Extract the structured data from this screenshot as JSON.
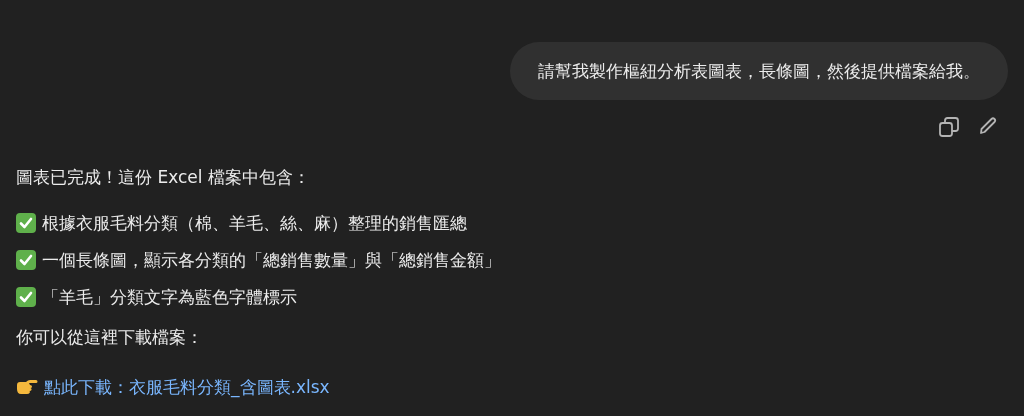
{
  "user_message": {
    "text": "請幫我製作樞紐分析表圖表，長條圖，然後提供檔案給我。"
  },
  "assistant_message": {
    "intro": "圖表已完成！這份 Excel 檔案中包含：",
    "checklist": [
      "根據衣服毛料分類（棉、羊毛、絲、麻）整理的銷售匯總",
      "一個長條圖，顯示各分類的「總銷售數量」與「總銷售金額」",
      "「羊毛」分類文字為藍色字體標示"
    ],
    "download_prompt": "你可以從這裡下載檔案：",
    "download_link": "點此下載：衣服毛料分類_含圖表.xlsx"
  }
}
